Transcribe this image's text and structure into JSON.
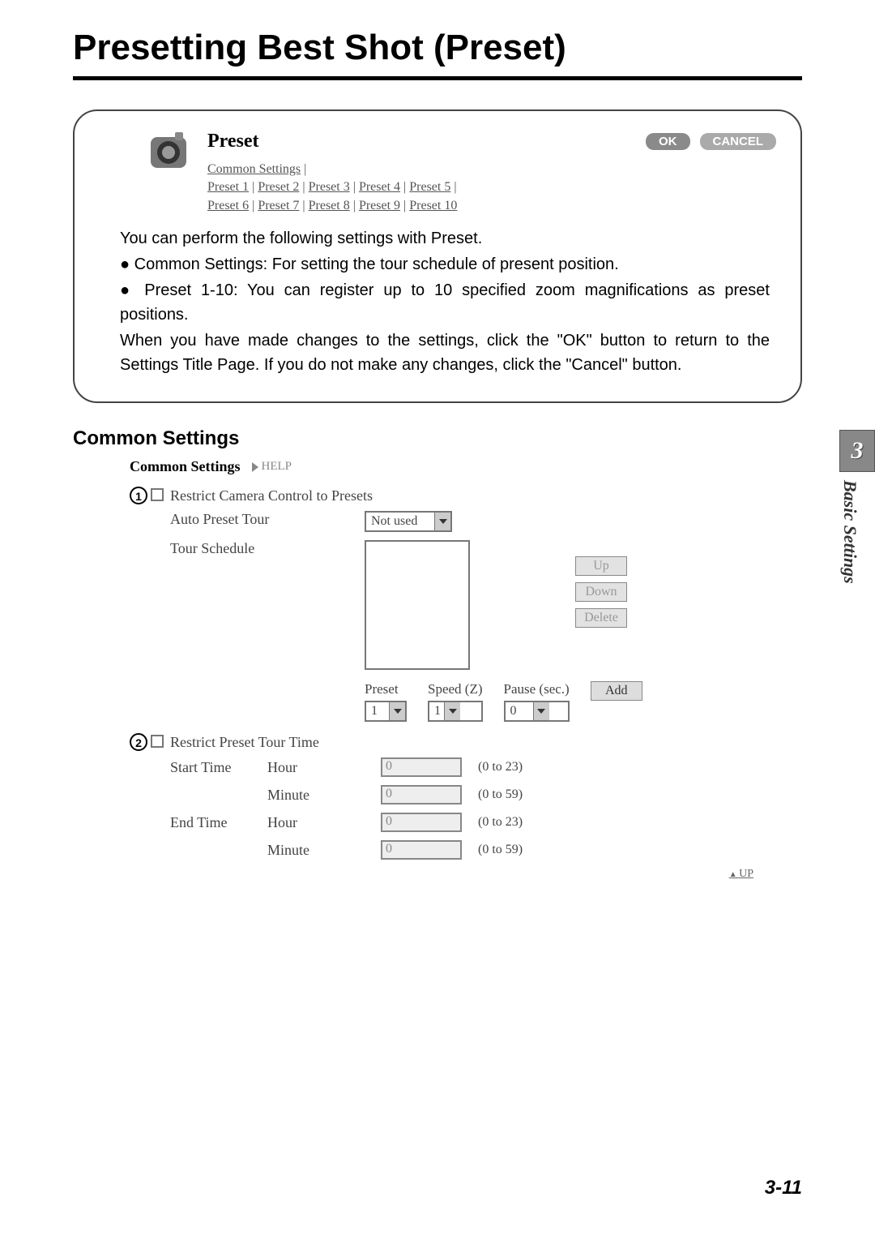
{
  "page_title": "Presetting Best Shot (Preset)",
  "side_tab": {
    "chapter": "3",
    "label": "Basic Settings"
  },
  "page_number": "3-11",
  "preset_header": {
    "title": "Preset",
    "ok": "OK",
    "cancel": "CANCEL",
    "link_common": "Common Settings",
    "links_row1": [
      "Preset 1",
      "Preset 2",
      "Preset 3",
      "Preset 4",
      "Preset 5"
    ],
    "links_row2": [
      "Preset 6",
      "Preset 7",
      "Preset 8",
      "Preset 9",
      "Preset 10"
    ]
  },
  "info": {
    "p1": "You can perform the following settings with Preset.",
    "b1": "Common Settings: For setting the tour schedule of present position.",
    "b2": "Preset 1-10: You can register up to 10 specified zoom magnifications as preset positions.",
    "p2": "When you have made changes to the settings, click the \"OK\" button to return to the Settings Title Page. If you do not make any changes, click the \"Cancel\" button."
  },
  "section_title": "Common Settings",
  "cs": {
    "heading": "Common Settings",
    "help": "HELP",
    "item1": {
      "num": "1",
      "restrict_label": "Restrict Camera Control to Presets",
      "auto_preset_tour": "Auto Preset Tour",
      "auto_preset_tour_value": "Not used",
      "tour_schedule": "Tour Schedule",
      "buttons": {
        "up": "Up",
        "down": "Down",
        "delete": "Delete",
        "add": "Add"
      },
      "psp": {
        "preset_label": "Preset",
        "preset_value": "1",
        "speed_label": "Speed (Z)",
        "speed_value": "1",
        "pause_label": "Pause (sec.)",
        "pause_value": "0"
      }
    },
    "item2": {
      "num": "2",
      "restrict_label": "Restrict Preset Tour Time",
      "start_time": "Start Time",
      "end_time": "End Time",
      "hour": "Hour",
      "minute": "Minute",
      "start_hour_value": "0",
      "start_minute_value": "0",
      "end_hour_value": "0",
      "end_minute_value": "0",
      "range_hour": "(0 to 23)",
      "range_minute": "(0 to 59)"
    },
    "up_link": "UP"
  }
}
